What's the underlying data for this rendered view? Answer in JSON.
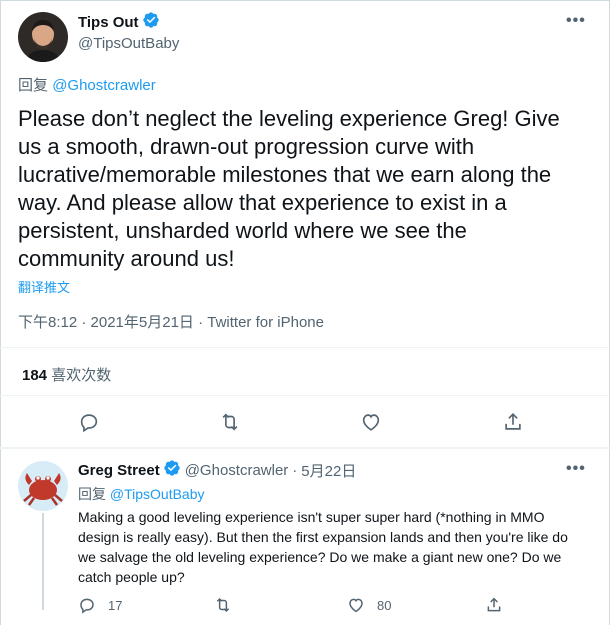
{
  "main_tweet": {
    "author_name": "Tips Out",
    "author_handle": "@TipsOutBaby",
    "reply_prefix": "回复",
    "reply_to": "@Ghostcrawler",
    "text": "Please don’t neglect the leveling experience Greg! Give us a smooth, drawn-out progression curve with lucrative/memorable milestones that we earn along the way. And please allow that experience to exist in a persistent, unsharded world where we see the community around us!",
    "translate_label": "翻译推文",
    "meta": "下午8:12 · 2021年5月21日 · Twitter for iPhone",
    "likes_count": "184",
    "likes_label": "喜欢次数"
  },
  "reply_tweet": {
    "author_name": "Greg Street",
    "author_handle": "@Ghostcrawler",
    "separator": "·",
    "date": "5月22日",
    "reply_prefix": "回复",
    "reply_to": "@TipsOutBaby",
    "text": "Making a good leveling experience isn't super super hard (*nothing in MMO design is really easy). But then the first expansion lands and then you're like do we salvage the old leveling experience? Do we make a giant new one? Do we catch people up?",
    "reply_count": "17",
    "like_count": "80"
  },
  "more_label": "•••",
  "colors": {
    "accent": "#1d9bf0",
    "text": "#0f1419",
    "muted": "#536471",
    "border": "#cfd9de"
  }
}
